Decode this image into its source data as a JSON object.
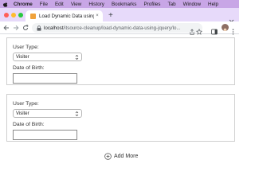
{
  "menubar": {
    "app": "Chrome",
    "items": [
      "File",
      "Edit",
      "View",
      "History",
      "Bookmarks",
      "Profiles",
      "Tab",
      "Window",
      "Help"
    ]
  },
  "tab": {
    "title": "Load Dynamic Data using jQuer",
    "close": "×"
  },
  "newtab": "+",
  "address": {
    "host": "localhost",
    "path": "/itsource-cleanup/load-dynamic-data-using-jquery/lo..."
  },
  "forms": [
    {
      "user_type_label": "User Type:",
      "user_type_value": "Visiter",
      "dob_label": "Date of Birth:",
      "dob_value": ""
    },
    {
      "user_type_label": "User Type:",
      "user_type_value": "Visiter",
      "dob_label": "Date of Birth:",
      "dob_value": ""
    }
  ],
  "add_more_label": "Add More",
  "icons": {
    "apple": "apple-icon",
    "back": "back-arrow-icon",
    "forward": "forward-arrow-icon",
    "reload": "reload-icon",
    "lock": "lock-icon",
    "share": "share-icon",
    "bookmark": "star-icon",
    "sidepanel": "side-panel-icon",
    "profile": "profile-avatar",
    "menu": "kebab-menu-icon",
    "add": "plus-circle-icon"
  },
  "colors": {
    "menubar": "#c8a6e6",
    "tabstrip": "#e7dafa",
    "favicon": "#f0a23b"
  }
}
